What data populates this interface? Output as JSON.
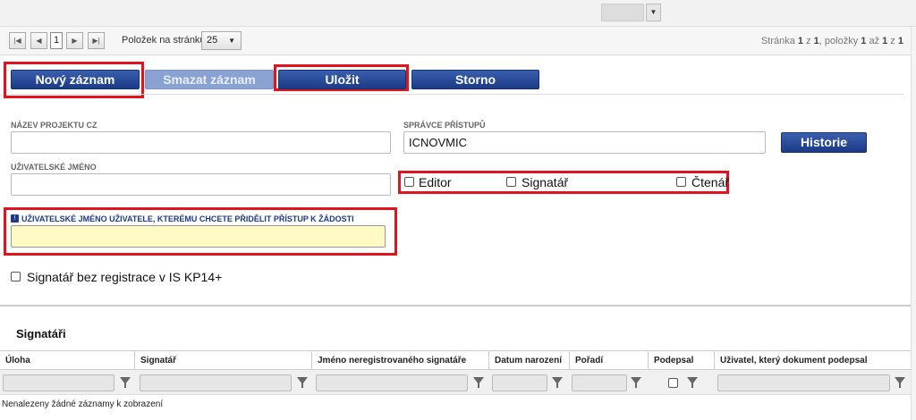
{
  "pager": {
    "first_icon": "first-page-icon",
    "prev_icon": "prev-page-icon",
    "next_icon": "next-page-icon",
    "last_icon": "last-page-icon",
    "current_page": "1",
    "per_page_label": "Položek na stránku",
    "per_page_value": "25",
    "info_prefix": "Stránka ",
    "info_page": "1",
    "info_mid1": " z ",
    "info_total_pages": "1",
    "info_mid2": ", položky ",
    "info_from": "1",
    "info_mid3": " až ",
    "info_to": "1",
    "info_mid4": " z ",
    "info_total": "1"
  },
  "toolbar": {
    "new_label": "Nový záznam",
    "delete_label": "Smazat záznam",
    "save_label": "Uložit",
    "cancel_label": "Storno"
  },
  "form": {
    "project_name_label": "Název projektu CZ",
    "project_name_value": "",
    "access_admin_label": "Správce přístupů",
    "access_admin_value": "ICNOVMIC",
    "history_label": "Historie",
    "username_label": "Uživatelské jméno",
    "username_value": "",
    "role_editor": "Editor",
    "role_signatory": "Signatář",
    "role_reader": "Čtenář",
    "grant_user_label": "Uživatelské jméno uživatele, kterému chcete přidělit přístup k žádosti",
    "grant_user_value": "",
    "unregistered_signatory_label": "Signatář bez registrace v IS KP14+"
  },
  "signatories": {
    "title": "Signatáři",
    "columns": [
      "Úloha",
      "Signatář",
      "Jméno neregistrovaného signatáře",
      "Datum narození",
      "Pořadí",
      "Podepsal",
      "Uživatel, který dokument podepsal"
    ],
    "empty_text": "Nenalezeny žádné záznamy k zobrazení"
  },
  "colors": {
    "button_primary": "#1c3a86",
    "button_disabled": "#8aa2d2",
    "highlight_red": "#e0141e",
    "required_field_bg": "#fff9c4"
  }
}
